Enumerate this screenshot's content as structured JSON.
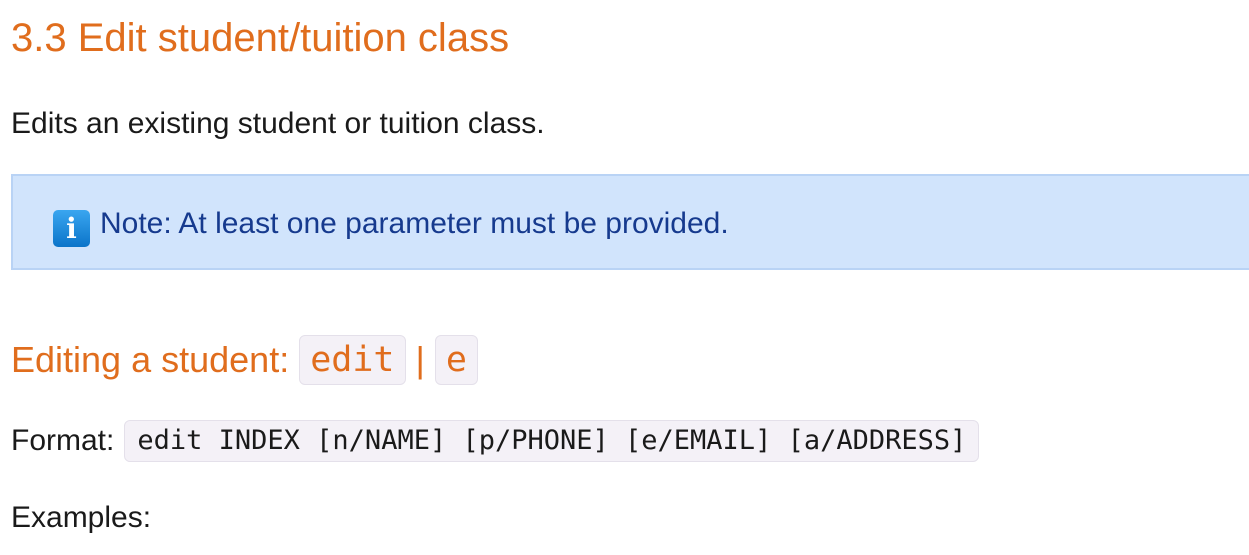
{
  "section": {
    "title": "3.3 Edit student/tuition class",
    "intro": "Edits an existing student or tuition class."
  },
  "note": {
    "icon": "info-icon",
    "icon_glyph": "i",
    "text": "Note: At least one parameter must be provided."
  },
  "subsection": {
    "title_prefix": "Editing a student: ",
    "command": "edit",
    "separator": "|",
    "alias": "e"
  },
  "format": {
    "label": "Format:",
    "command": "edit INDEX [n/NAME] [p/PHONE] [e/EMAIL] [a/ADDRESS]"
  },
  "examples": {
    "label": "Examples:"
  },
  "colors": {
    "heading": "#e06d1d",
    "note_background": "#d1e4fc",
    "note_text": "#163a8e",
    "code_background": "#f4f1f7"
  }
}
